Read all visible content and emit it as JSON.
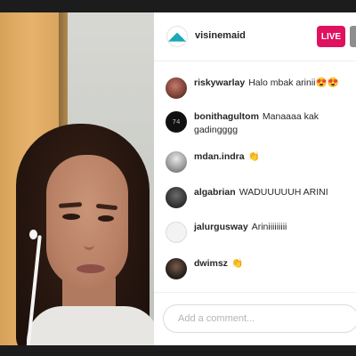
{
  "host": {
    "username": "visinemaid",
    "live_label": "LIVE",
    "avatar_icon": "visinema-logo-icon",
    "brand_color": "#1aa6b7",
    "live_color": "#e0115f"
  },
  "comments": [
    {
      "user": "riskywarlay",
      "message": "Halo mbak arinii😍😍"
    },
    {
      "user": "bonithagultom",
      "message": "Manaaaa kak gadingggg"
    },
    {
      "user": "mdan.indra",
      "message": "👏"
    },
    {
      "user": "algabrian",
      "message": "WADUUUUUH ARINI"
    },
    {
      "user": "jalurgusway",
      "message": "Ariniiiiiiiii"
    },
    {
      "user": "dwimsz",
      "message": "👏"
    }
  ],
  "comment_box": {
    "placeholder": "Add a comment..."
  }
}
